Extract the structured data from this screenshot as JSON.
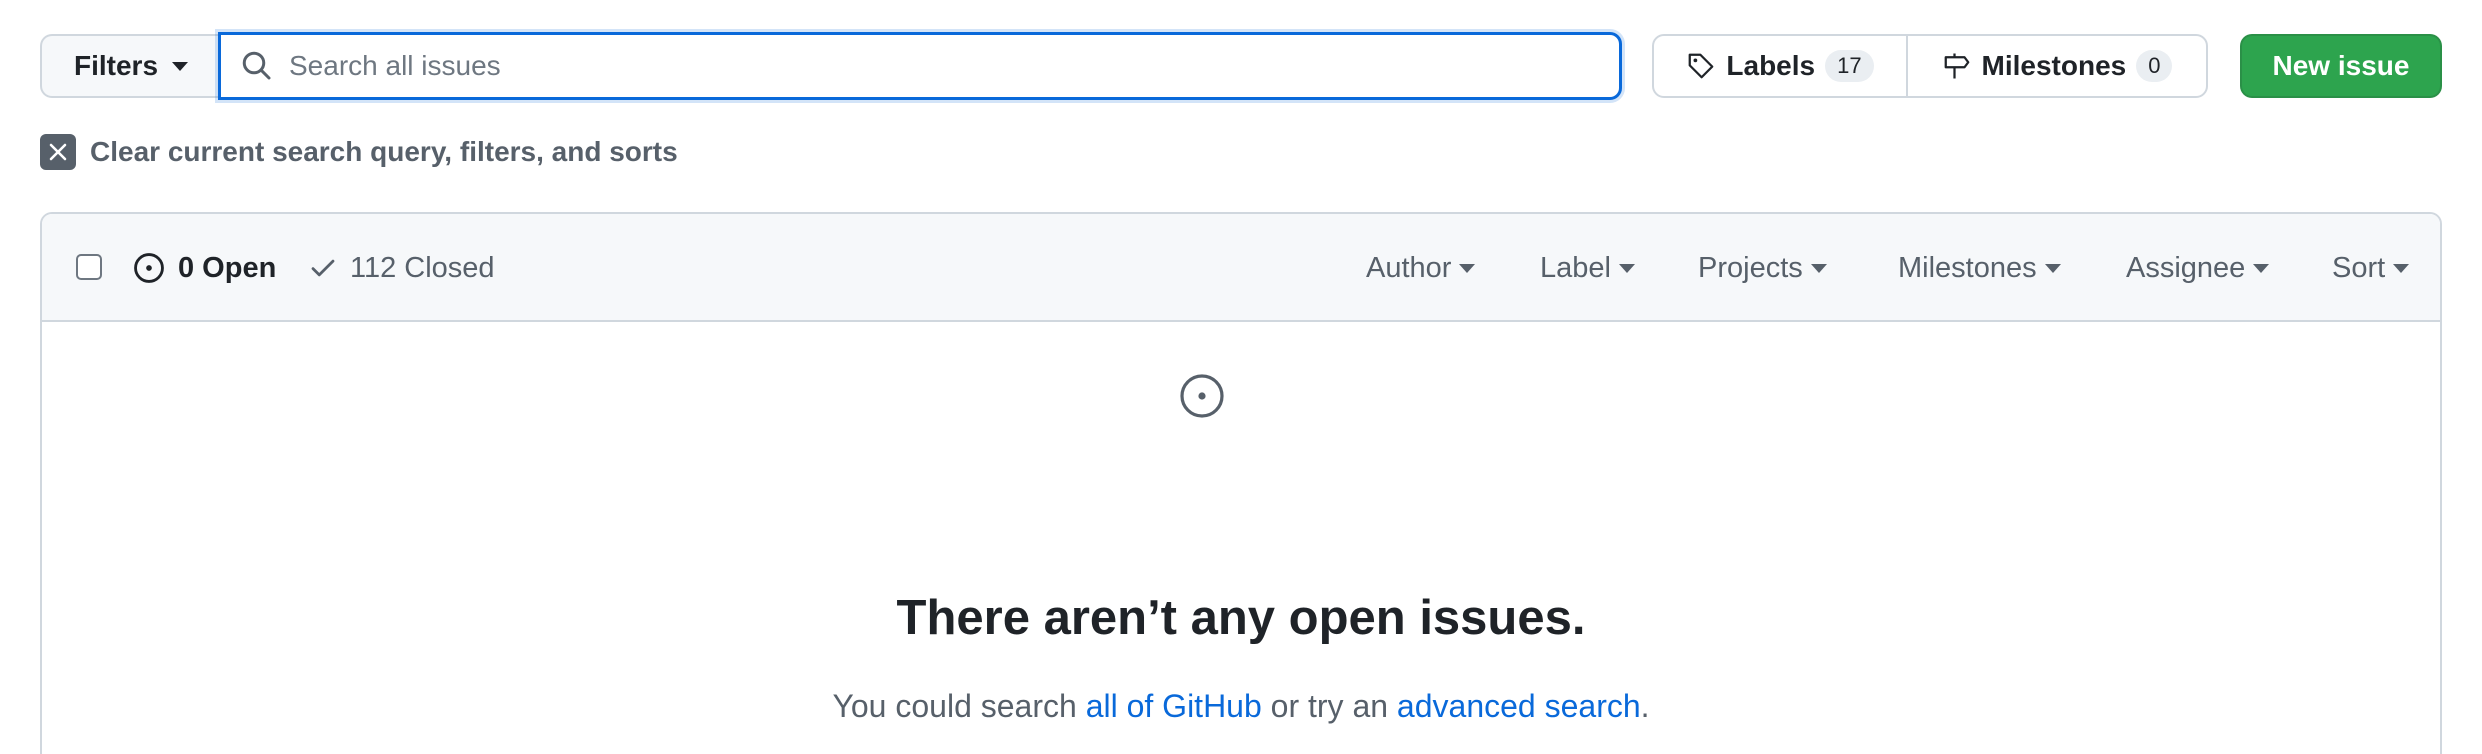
{
  "toolbar": {
    "filters_label": "Filters",
    "search_placeholder": "Search all issues",
    "search_value": "",
    "labels_label": "Labels",
    "labels_count": "17",
    "milestones_label": "Milestones",
    "milestones_count": "0",
    "new_issue_label": "New issue",
    "accent_color": "#2da44e",
    "focus_color": "#0969da"
  },
  "clear_query": {
    "label": "Clear current search query, filters, and sorts"
  },
  "issues_header": {
    "open_label": "0 Open",
    "closed_label": "112 Closed",
    "filters": [
      "Author",
      "Label",
      "Projects",
      "Milestones",
      "Assignee",
      "Sort"
    ]
  },
  "blank_slate": {
    "title": "There aren’t any open issues.",
    "text_before": "You could search ",
    "link_all": "all of GitHub",
    "text_middle": " or try an ",
    "link_advanced": "advanced search",
    "text_after": "."
  },
  "icons": {
    "search": "search-icon",
    "tag": "tag-icon",
    "milestone": "milestone-icon",
    "close": "close-icon",
    "issue_open": "issue-opened-icon",
    "check": "check-icon",
    "caret": "caret-down-icon"
  }
}
